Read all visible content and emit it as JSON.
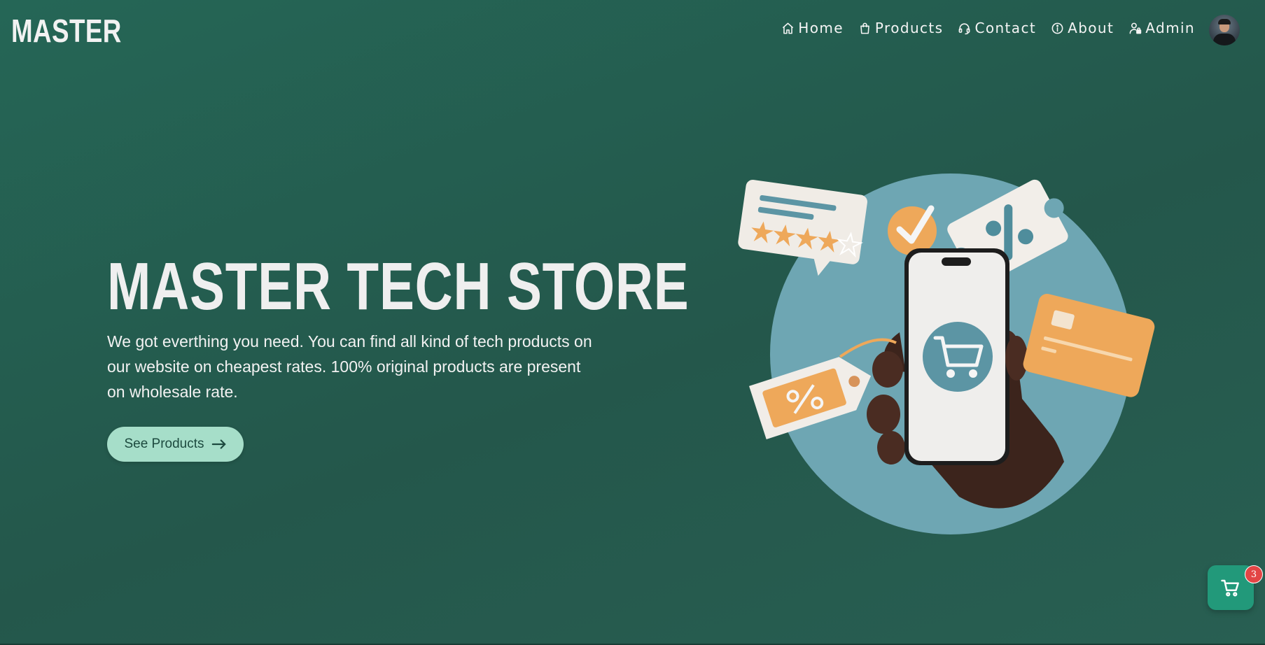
{
  "brand": {
    "logo_text": "MASTER"
  },
  "nav": {
    "items": [
      {
        "label": "Home",
        "icon": "home-icon"
      },
      {
        "label": "Products",
        "icon": "shopping-bag-icon"
      },
      {
        "label": "Contact",
        "icon": "headset-icon"
      },
      {
        "label": "About",
        "icon": "info-icon"
      },
      {
        "label": "Admin",
        "icon": "user-lock-icon"
      }
    ],
    "avatar": "user-avatar"
  },
  "hero": {
    "title": "MASTER TECH STORE",
    "description": "We got everthing you need. You can find all kind of tech products on our website on cheapest rates. 100% original products are present on wholesale rate.",
    "cta_label": "See Products",
    "cta_icon": "arrow-right-icon",
    "illustration": "hand-holding-phone-shopping-illustration"
  },
  "cart": {
    "icon": "shopping-cart-icon",
    "count": "3"
  },
  "colors": {
    "background": "#256656",
    "cta_bg": "#a6dec9",
    "cart_bg": "#22997a",
    "badge": "#e34545",
    "illustration_circle": "#6ea6b3",
    "accent_orange": "#eea85a"
  }
}
